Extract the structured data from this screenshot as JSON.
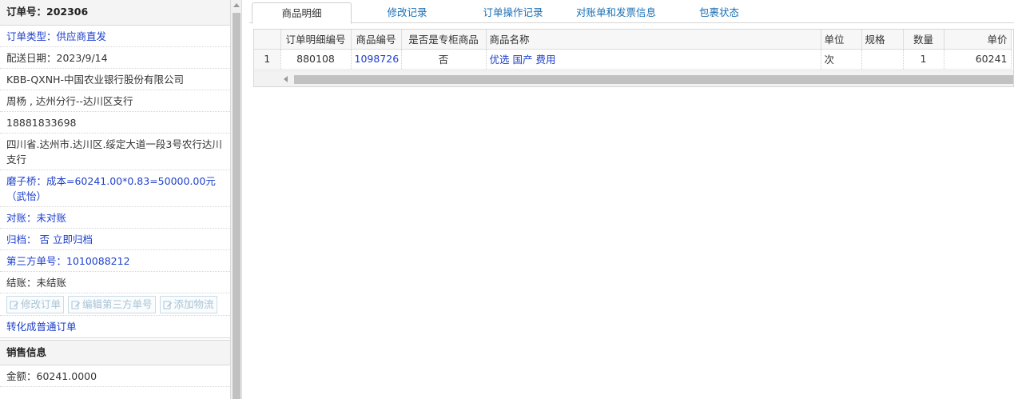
{
  "order": {
    "number_label": "订单号：",
    "number": "202306"
  },
  "details": [
    {
      "text": "订单类型：供应商直发",
      "blue": true
    },
    {
      "text": "配送日期：2023/9/14",
      "blue": false
    },
    {
      "text": "KBB-QXNH-中国农业银行股份有限公司",
      "blue": false
    },
    {
      "text": "周杨 , 达州分行--达川区支行",
      "blue": false
    },
    {
      "text": "18881833698",
      "blue": false
    },
    {
      "text": "四川省.达州市.达川区.绥定大道一段3号农行达川支行",
      "blue": false
    },
    {
      "text": "磨子桥：成本=60241.00*0.83=50000.00元（武怡）",
      "blue": true
    },
    {
      "text": "对账：未对账",
      "blue": true
    },
    {
      "text": "归档： 否 立即归档",
      "blue": true
    },
    {
      "text": "第三方单号：1010088212",
      "blue": true
    },
    {
      "text": "结账：未结账",
      "blue": false
    }
  ],
  "buttons": {
    "modify_order": "修改订单",
    "edit_third_party": "编辑第三方单号",
    "add_logistics": "添加物流"
  },
  "convert_link": "转化成普通订单",
  "sales": {
    "title": "销售信息",
    "amount": "金额：60241.0000"
  },
  "tabs": [
    {
      "label": "商品明细",
      "active": true
    },
    {
      "label": "修改记录",
      "active": false
    },
    {
      "label": "订单操作记录",
      "active": false
    },
    {
      "label": "对账单和发票信息",
      "active": false
    },
    {
      "label": "包裹状态",
      "active": false
    }
  ],
  "table": {
    "headers": [
      "",
      "订单明细编号",
      "商品编号",
      "是否是专柜商品",
      "商品名称",
      "单位",
      "规格",
      "数量",
      "单价"
    ],
    "rows": [
      [
        "1",
        "880108",
        "1098726",
        "否",
        "优选 国产 费用",
        "次",
        "",
        "1",
        "60241"
      ]
    ]
  }
}
